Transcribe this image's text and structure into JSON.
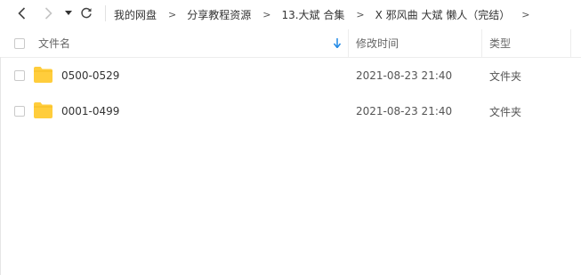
{
  "nav": {
    "back_icon": "chevron-left-icon",
    "forward_icon": "chevron-right-icon",
    "dropdown_icon": "caret-down-icon",
    "refresh_icon": "refresh-icon",
    "breadcrumb": [
      "我的网盘",
      "分享教程资源",
      "13.大斌 合集",
      "X 邪风曲  大斌 懒人（完结）"
    ],
    "separator": ">"
  },
  "table": {
    "columns": {
      "name": "文件名",
      "modified": "修改时间",
      "type": "类型"
    },
    "sort_icon": "sort-down-arrow-icon",
    "rows": [
      {
        "name": "0500-0529",
        "modified": "2021-08-23 21:40",
        "type": "文件夹",
        "icon": "folder-icon"
      },
      {
        "name": "0001-0499",
        "modified": "2021-08-23 21:40",
        "type": "文件夹",
        "icon": "folder-icon"
      }
    ]
  },
  "colors": {
    "folder": "#ffcd3c",
    "sort_arrow": "#1e88e5",
    "border": "#ededed"
  }
}
